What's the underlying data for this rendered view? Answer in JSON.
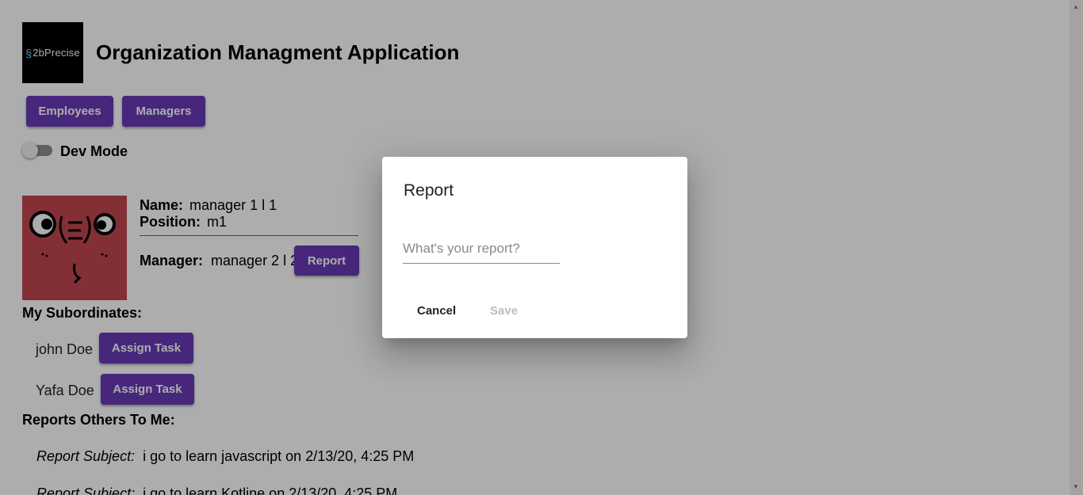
{
  "header": {
    "logo_text": "2bPrecise",
    "title": "Organization Managment Application"
  },
  "nav": {
    "employees_label": "Employees",
    "managers_label": "Managers"
  },
  "dev_mode": {
    "label": "Dev Mode",
    "enabled": false
  },
  "profile": {
    "name_label": "Name:",
    "name_value": "manager 1 l 1",
    "position_label": "Position:",
    "position_value": "m1",
    "manager_label": "Manager:",
    "manager_value": "manager 2 l 2",
    "report_button": "Report"
  },
  "subordinates": {
    "title": "My Subordinates:",
    "items": [
      {
        "name": "john Doe",
        "button": "Assign Task"
      },
      {
        "name": "Yafa Doe",
        "button": "Assign Task"
      }
    ]
  },
  "reports": {
    "title": "Reports Others To Me:",
    "items": [
      {
        "subject_label": "Report Subject:",
        "text": "i go to learn javascript on 2/13/20, 4:25 PM"
      },
      {
        "subject_label": "Report Subject:",
        "text": "i go to learn Kotline on 2/13/20, 4:25 PM"
      }
    ]
  },
  "dialog": {
    "title": "Report",
    "input_placeholder": "What's your report?",
    "input_value": "",
    "cancel_label": "Cancel",
    "save_label": "Save",
    "save_disabled": true
  },
  "colors": {
    "primary": "#673ab7",
    "avatar_bg": "#c14650",
    "overlay": "rgba(0,0,0,0.32)"
  }
}
